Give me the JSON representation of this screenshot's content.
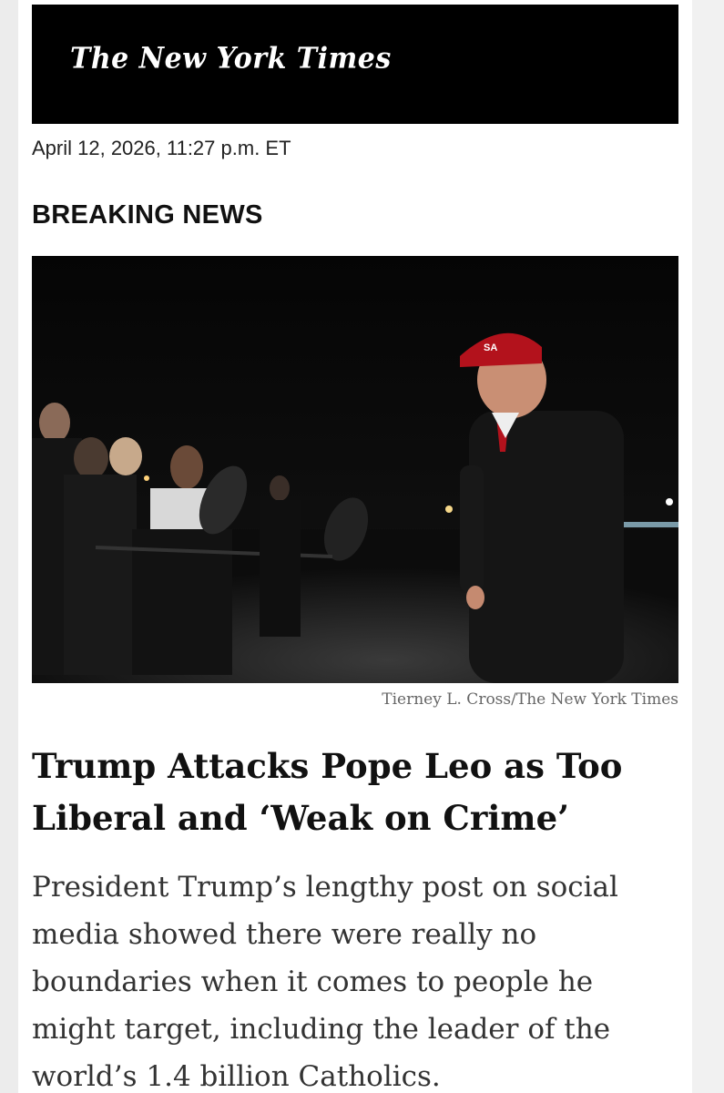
{
  "masthead": {
    "logo_text": "The New York Times"
  },
  "article": {
    "dateline": "April 12, 2026, 11:27 p.m. ET",
    "kicker": "BREAKING NEWS",
    "photo_credit": "Tierney L. Cross/The New York Times",
    "headline": "Trump Attacks Pope Leo as Too Liberal and ‘Weak on Crime’",
    "summary": "President Trump’s lengthy post on social media showed there were really no boundaries when it comes to people he might target, including the leader of the world’s 1.4 billion Catholics."
  },
  "colors": {
    "masthead_bg": "#000000",
    "photo_bg": "#050505",
    "hat_red": "#b3121c",
    "text_dark": "#111111",
    "text_gray": "#666666"
  }
}
